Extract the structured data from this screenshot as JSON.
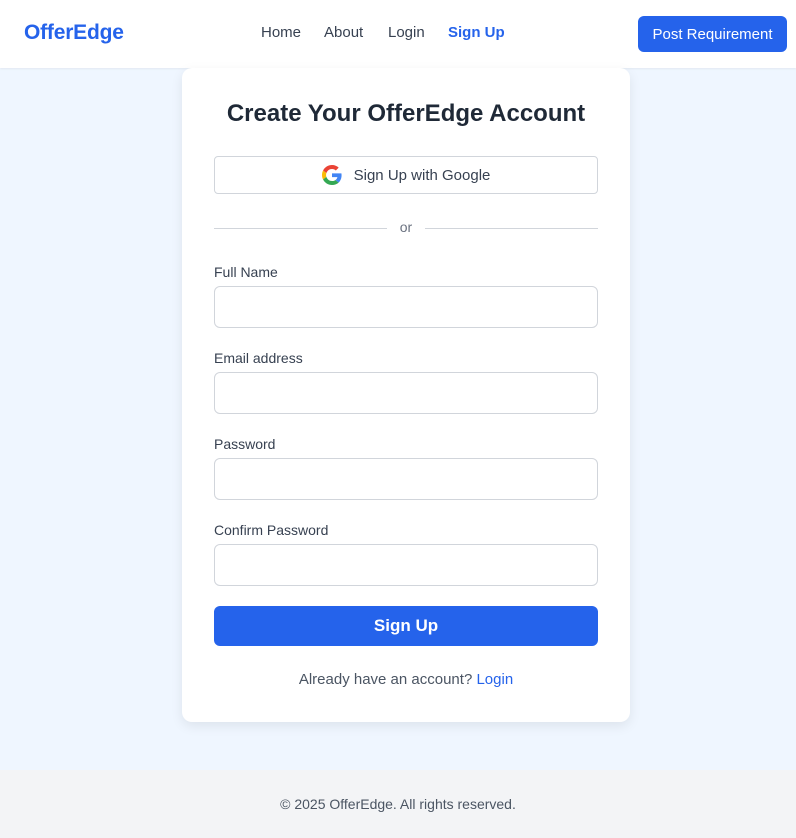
{
  "header": {
    "logo": "OfferEdge",
    "nav": [
      "Home",
      "About",
      "Login",
      "Sign Up"
    ],
    "active_nav": "Sign Up",
    "post_button": "Post Requirement"
  },
  "form": {
    "title": "Create Your OfferEdge Account",
    "google_button": "Sign Up with Google",
    "google_icon": "google-g-icon",
    "divider": "or",
    "fields": [
      {
        "label": "Full Name",
        "value": "",
        "placeholder": ""
      },
      {
        "label": "Email address",
        "value": "",
        "placeholder": ""
      },
      {
        "label": "Password",
        "value": "",
        "placeholder": ""
      },
      {
        "label": "Confirm Password",
        "value": "",
        "placeholder": ""
      }
    ],
    "submit": "Sign Up",
    "login_prompt": "Already have an account?",
    "login_link": "Login"
  },
  "footer": {
    "text": "© 2025 OfferEdge. All rights reserved."
  },
  "colors": {
    "primary": "#2563eb",
    "page_background": "#eff6ff",
    "footer_background": "#f3f4f6"
  }
}
